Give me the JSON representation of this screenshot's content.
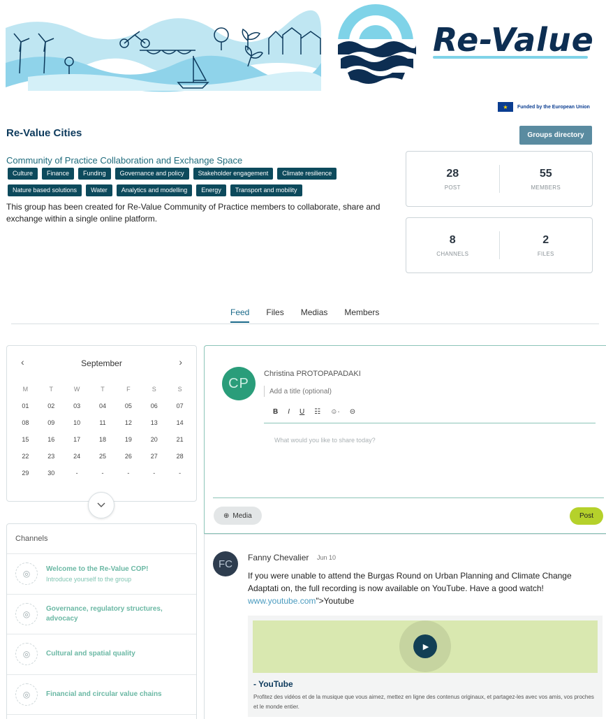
{
  "banner": {
    "logo_text": "Re-Value"
  },
  "eu": {
    "funded_text": "Funded by the European Union"
  },
  "group": {
    "title": "Re-Value Cities",
    "directory_button": "Groups directory",
    "subtitle": "Community of Practice Collaboration and Exchange Space",
    "tags": [
      "Culture",
      "Finance",
      "Funding",
      "Governance and policy",
      "Stakeholder engagement",
      "Climate resilience",
      "Nature based solutions",
      "Water",
      "Analytics and modelling",
      "Energy",
      "Transport and mobility"
    ],
    "description": "This group has been created for Re-Value Community of Practice members to collaborate, share and exchange within a single online platform."
  },
  "stats": {
    "post": {
      "value": "28",
      "label": "POST"
    },
    "members": {
      "value": "55",
      "label": "MEMBERS"
    },
    "channels": {
      "value": "8",
      "label": "CHANNELS"
    },
    "files": {
      "value": "2",
      "label": "FILES"
    }
  },
  "tabs": [
    "Feed",
    "Files",
    "Medias",
    "Members"
  ],
  "active_tab": "Feed",
  "calendar": {
    "month": "September",
    "prev": "‹",
    "next": "›",
    "weekdays": [
      "M",
      "T",
      "W",
      "T",
      "F",
      "S",
      "S"
    ],
    "days": [
      "01",
      "02",
      "03",
      "04",
      "05",
      "06",
      "07",
      "08",
      "09",
      "10",
      "11",
      "12",
      "13",
      "14",
      "15",
      "16",
      "17",
      "18",
      "19",
      "20",
      "21",
      "22",
      "23",
      "24",
      "25",
      "26",
      "27",
      "28",
      "29",
      "30",
      "-",
      "-",
      "-",
      "-",
      "-"
    ]
  },
  "channels": {
    "title": "Channels",
    "items": [
      {
        "name": "Welcome to the Re-Value COP!",
        "sub": "Introduce yourself to the group"
      },
      {
        "name": "Governance, regulatory structures, advocacy",
        "sub": ""
      },
      {
        "name": "Cultural and spatial quality",
        "sub": ""
      },
      {
        "name": "Financial and circular value chains",
        "sub": ""
      }
    ]
  },
  "composer": {
    "avatar_initials": "CP",
    "author": "Christina PROTOPAPADAKI",
    "title_placeholder": "Add a title (optional)",
    "toolbar": {
      "bold": "B",
      "italic": "I",
      "underline": "U",
      "list": "☷",
      "emoji": "☺·",
      "link": "⊝"
    },
    "share_placeholder": "What would you like to share today?",
    "media_label": "Media",
    "post_label": "Post"
  },
  "post": {
    "avatar_initials": "FC",
    "author": "Fanny Chevalier",
    "date": "Jun 10",
    "body_text": "If you were unable to attend the Burgas Round on Urban Planning and Climate Change Adaptati on, the full recording is now available on YouTube. Have a good watch!",
    "link_text": "www.youtube.com",
    "link_suffix": "\">Youtube",
    "card_title": "- YouTube",
    "card_desc": "Profitez des vidéos et de la musique que vous aimez, mettez en ligne des contenus originaux, et partagez-les avec vos amis, vos proches et le monde entier."
  },
  "colors": {
    "primary": "#0d4a5c",
    "accent": "#b5d12b",
    "link": "#4a9bbf",
    "channel_text": "#6bb8a4"
  }
}
